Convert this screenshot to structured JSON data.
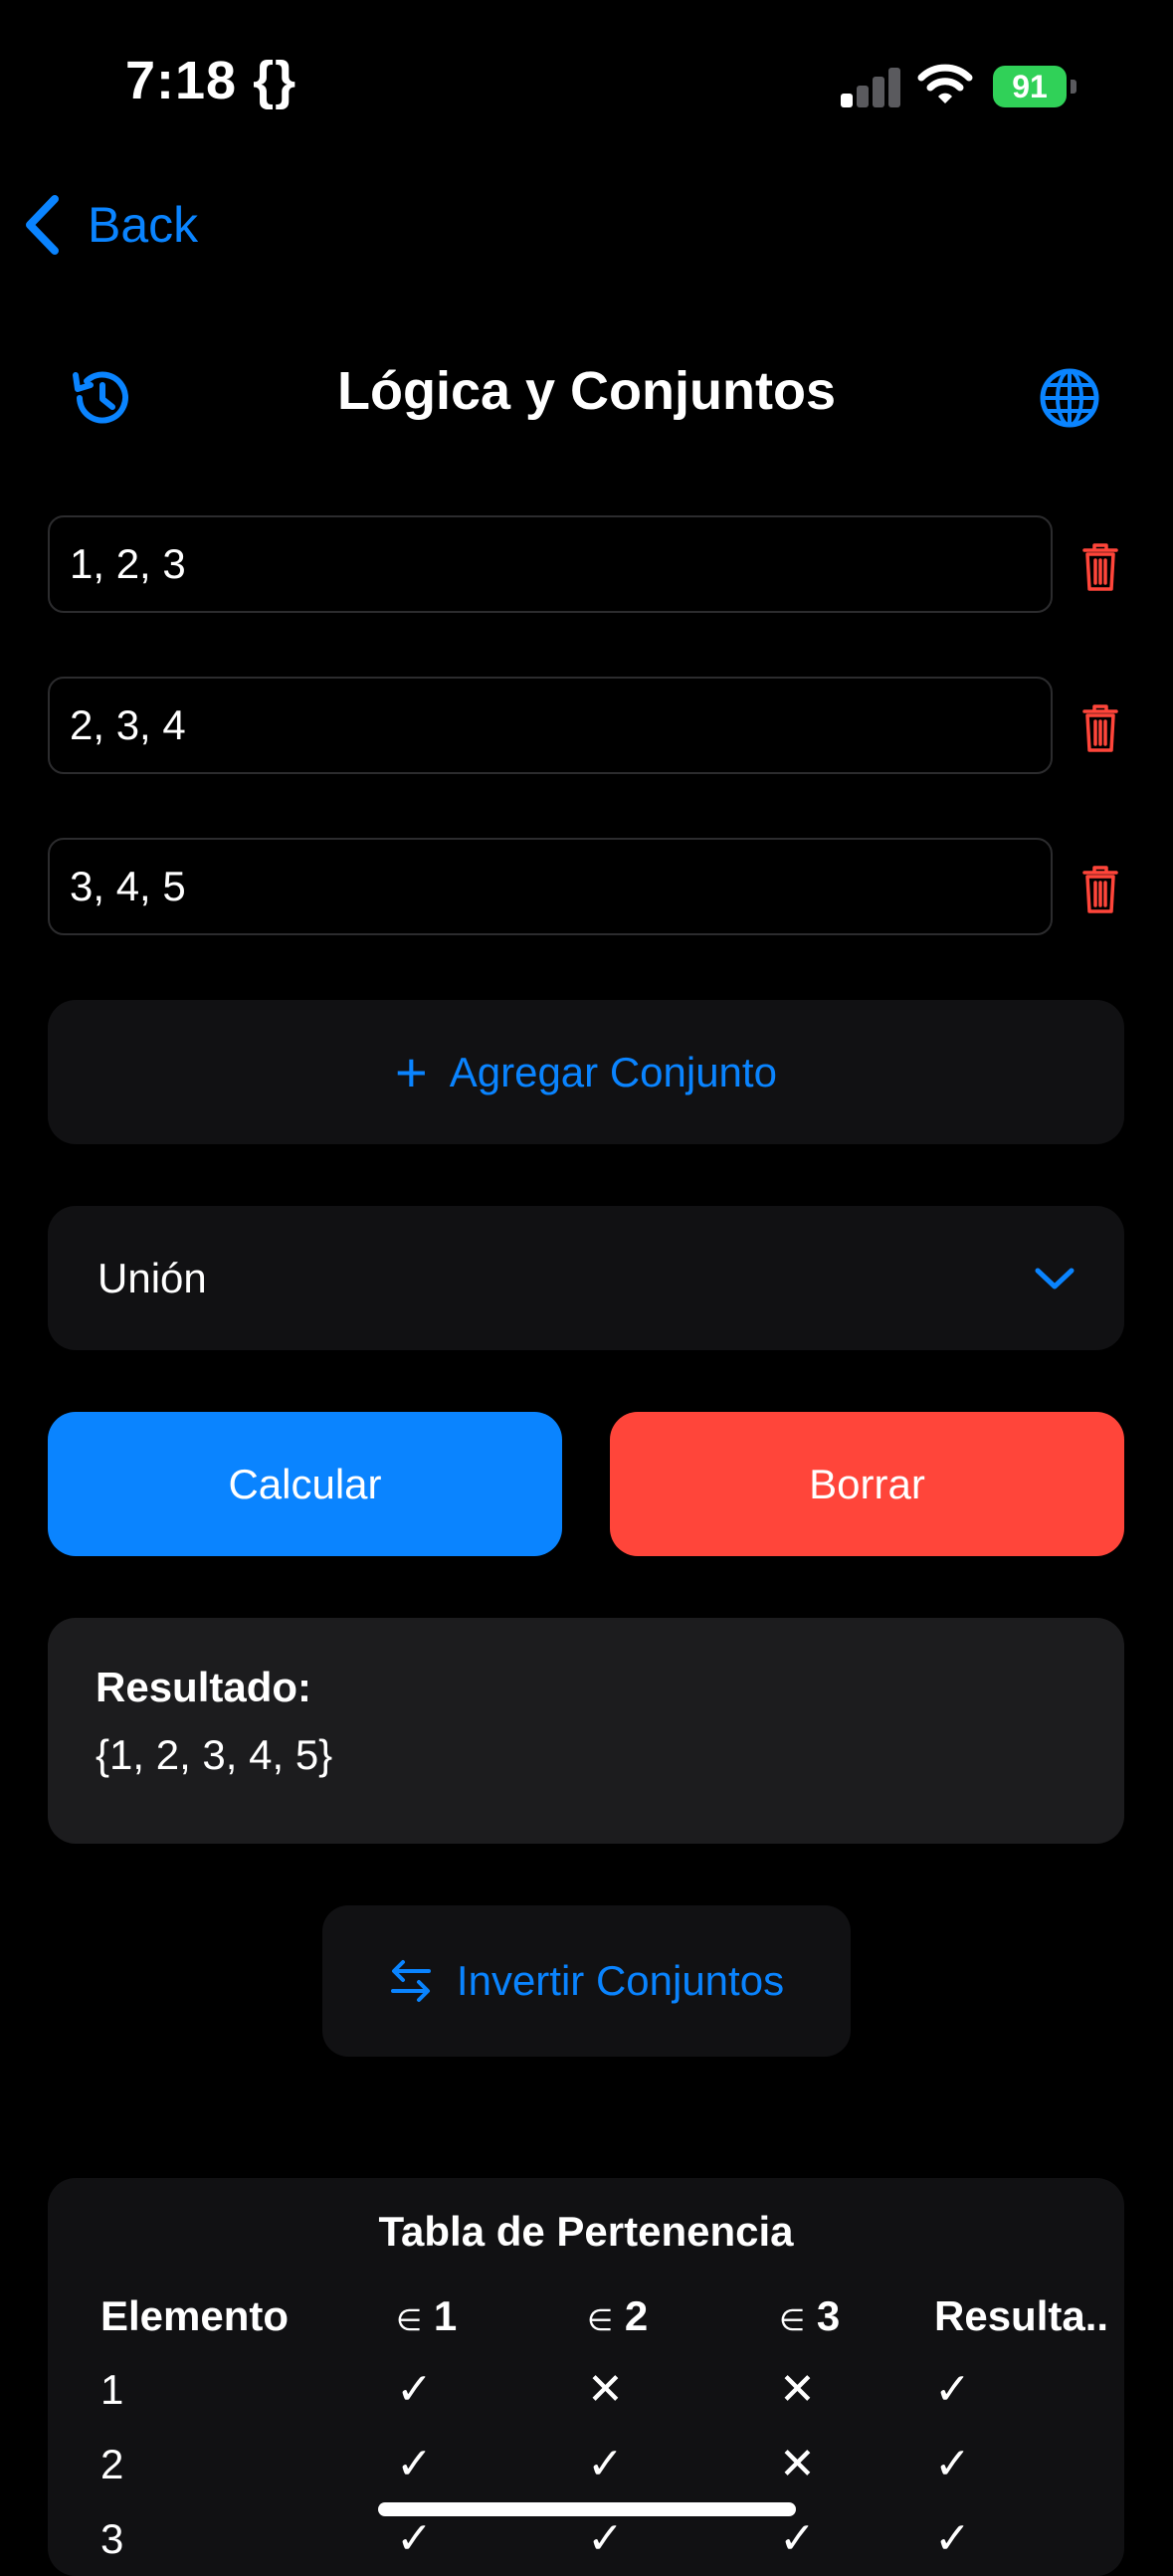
{
  "status": {
    "time": "7:18 {}",
    "battery": "91"
  },
  "nav": {
    "back_label": "Back"
  },
  "header": {
    "title": "Lógica y Conjuntos"
  },
  "sets": [
    {
      "value": "1, 2, 3"
    },
    {
      "value": "2, 3, 4"
    },
    {
      "value": "3, 4, 5"
    }
  ],
  "add_set": {
    "plus": "+",
    "label": "Agregar Conjunto"
  },
  "operation": {
    "selected": "Unión"
  },
  "actions": {
    "calculate": "Calcular",
    "clear": "Borrar"
  },
  "result": {
    "label": "Resultado:",
    "value": "{1, 2, 3, 4, 5}"
  },
  "invert": {
    "label": "Invertir Conjuntos"
  },
  "membership_table": {
    "title": "Tabla de Pertenencia",
    "headers": {
      "element": "Elemento",
      "set1_symbol": "∈",
      "set1_num": "1",
      "set2_symbol": "∈",
      "set2_num": "2",
      "set3_symbol": "∈",
      "set3_num": "3",
      "result": "Resulta.."
    },
    "rows": [
      {
        "element": "1",
        "in1": "✓",
        "in2": "✕",
        "in3": "✕",
        "result": "✓"
      },
      {
        "element": "2",
        "in1": "✓",
        "in2": "✓",
        "in3": "✕",
        "result": "✓"
      },
      {
        "element": "3",
        "in1": "✓",
        "in2": "✓",
        "in3": "✓",
        "result": "✓"
      }
    ]
  },
  "colors": {
    "accent": "#0a84ff",
    "danger": "#ff453a",
    "battery": "#30d158"
  }
}
